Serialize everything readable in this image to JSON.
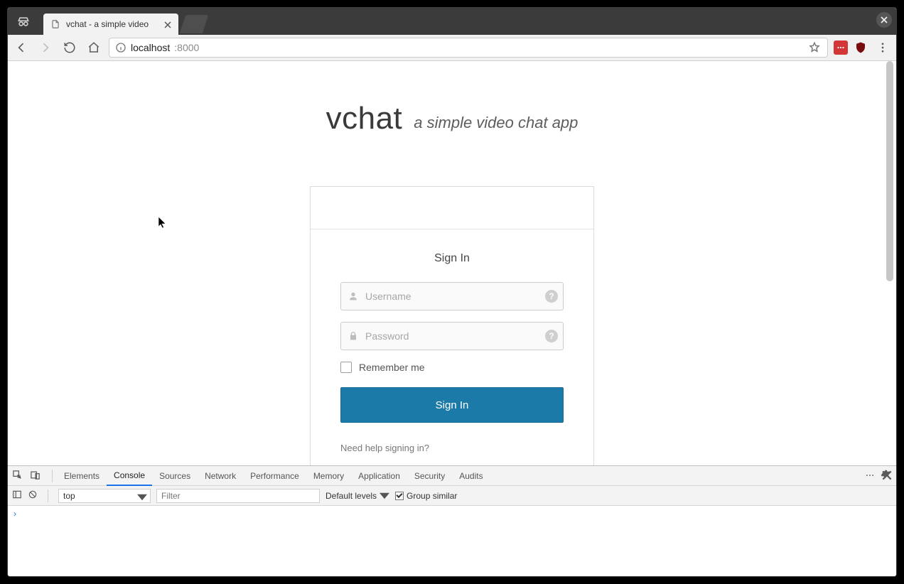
{
  "browser": {
    "tab_title": "vchat - a simple video",
    "url_host": "localhost",
    "url_port": ":8000"
  },
  "page": {
    "brand_title": "vchat",
    "brand_tagline": "a simple video chat app",
    "card": {
      "heading": "Sign In",
      "username_placeholder": "Username",
      "password_placeholder": "Password",
      "remember_label": "Remember me",
      "submit_label": "Sign In",
      "help_text": "Need help signing in?"
    }
  },
  "devtools": {
    "tabs": [
      "Elements",
      "Console",
      "Sources",
      "Network",
      "Performance",
      "Memory",
      "Application",
      "Security",
      "Audits"
    ],
    "active_tab": "Console",
    "context_select": "top",
    "filter_placeholder": "Filter",
    "levels_label": "Default levels",
    "group_similar_label": "Group similar",
    "prompt": "›"
  }
}
